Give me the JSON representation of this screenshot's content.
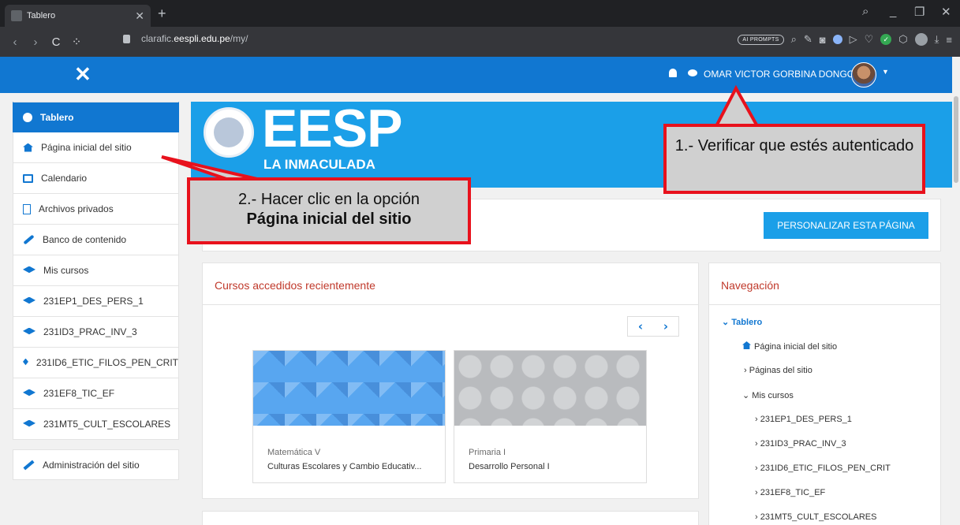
{
  "browser": {
    "tab_title": "Tablero",
    "tab_close": "✕",
    "new_tab": "+",
    "url_prefix": "clarafic.",
    "url_host": "eespli.edu.pe",
    "url_path": "/my/",
    "ai_prompts": "AI PROMPTS",
    "window_controls": {
      "search": "⌕",
      "minimize": "_",
      "restore": "❐",
      "close": "✕"
    },
    "nav": {
      "back": "‹",
      "forward": "›",
      "reload": "C",
      "apps": "⁘"
    }
  },
  "navbar": {
    "close_glyph": "✕",
    "user_name": "OMAR VICTOR GORBINA DONGO",
    "caret": "▼",
    "color": "#1177d1"
  },
  "sidebar": {
    "items": [
      {
        "label": "Tablero",
        "icon": "dashboard-icon",
        "active": true
      },
      {
        "label": "Página inicial del sitio",
        "icon": "home-icon"
      },
      {
        "label": "Calendario",
        "icon": "calendar-icon"
      },
      {
        "label": "Archivos privados",
        "icon": "file-icon"
      },
      {
        "label": "Banco de contenido",
        "icon": "brush-icon"
      },
      {
        "label": "Mis cursos",
        "icon": "graduation-cap-icon"
      },
      {
        "label": "231EP1_DES_PERS_1",
        "icon": "graduation-cap-icon"
      },
      {
        "label": "231ID3_PRAC_INV_3",
        "icon": "graduation-cap-icon"
      },
      {
        "label": "231ID6_ETIC_FILOS_PEN_CRIT",
        "icon": "graduation-cap-icon"
      },
      {
        "label": "231EF8_TIC_EF",
        "icon": "graduation-cap-icon"
      },
      {
        "label": "231MT5_CULT_ESCOLARES",
        "icon": "graduation-cap-icon"
      }
    ],
    "admin": {
      "label": "Administración del sitio",
      "icon": "wrench-icon"
    }
  },
  "banner": {
    "logo_text": "EESP",
    "subtitle": "LA INMACULADA",
    "color": "#1b9fe8"
  },
  "customize_button": "PERSONALIZAR ESTA PÁGINA",
  "recent": {
    "title": "Cursos accedidos recientemente",
    "prev": "‹",
    "next": "›",
    "cards": [
      {
        "category": "Matemática V",
        "name": "Culturas Escolares y Cambio Educativ..."
      },
      {
        "category": "Primaria I",
        "name": "Desarrollo Personal I"
      }
    ]
  },
  "navigation": {
    "title": "Navegación",
    "dashboard": "Tablero",
    "home": "Página inicial del sitio",
    "site_pages": "Páginas del sitio",
    "my_courses": "Mis cursos",
    "courses": [
      "231EP1_DES_PERS_1",
      "231ID3_PRAC_INV_3",
      "231ID6_ETIC_FILOS_PEN_CRIT",
      "231EF8_TIC_EF",
      "231MT5_CULT_ESCOLARES"
    ],
    "expanded_glyph": "⌄",
    "collapsed_glyph": "›"
  },
  "callouts": {
    "step1": "1.- Verificar que estés autenticado",
    "step2_line1": "2.- Hacer clic en la opción",
    "step2_line2": "Página inicial del sitio",
    "border_color": "#e8111c"
  }
}
